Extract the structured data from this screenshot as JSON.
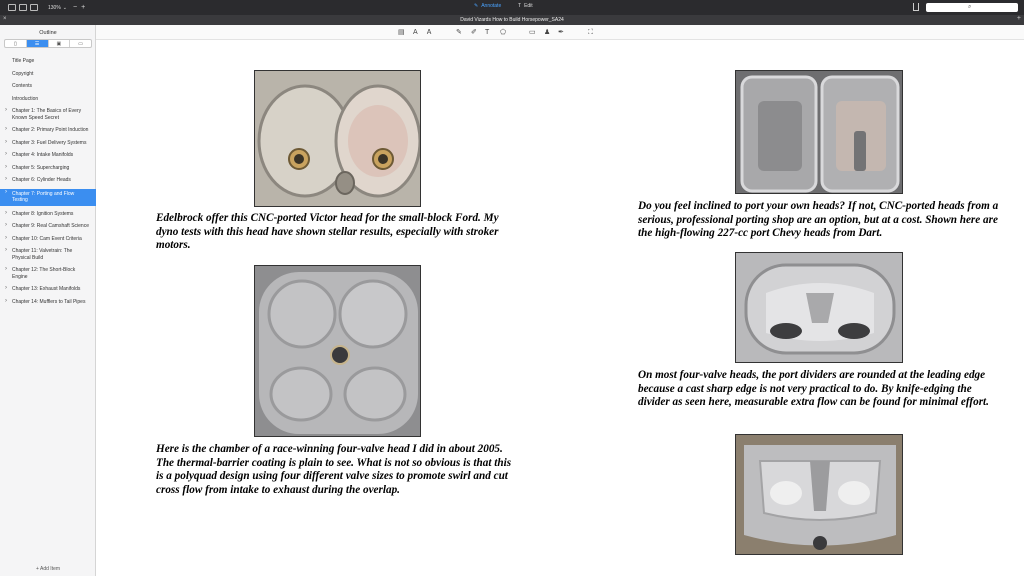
{
  "toolbar": {
    "zoom": "130%",
    "annotate_label": "Annotate",
    "edit_label": "Edit"
  },
  "document": {
    "title": "David Vizards How to Build Horsepower_SA24"
  },
  "sidebar": {
    "title": "Outline",
    "tabs": [
      "bookmark-icon",
      "outline-icon",
      "image-icon",
      "page-icon"
    ],
    "items": [
      {
        "label": "Title Page"
      },
      {
        "label": "Copyright"
      },
      {
        "label": "Contents"
      },
      {
        "label": "Introduction"
      },
      {
        "label": "Chapter 1: The Basics of Every Known Speed Secret"
      },
      {
        "label": "Chapter 2: Primary Point Induction"
      },
      {
        "label": "Chapter 3: Fuel Delivery Systems"
      },
      {
        "label": "Chapter 4: Intake Manifolds"
      },
      {
        "label": "Chapter 5: Supercharging"
      },
      {
        "label": "Chapter 6: Cylinder Heads"
      },
      {
        "label": "Chapter 7: Porting and Flow Testing"
      },
      {
        "label": "Chapter 8: Ignition Systems"
      },
      {
        "label": "Chapter 9: Real Camshaft Science"
      },
      {
        "label": "Chapter 10: Cam Event Criteria"
      },
      {
        "label": "Chapter 11: Valvetrain: The Physical Build"
      },
      {
        "label": "Chapter 12: The Short-Block Engine"
      },
      {
        "label": "Chapter 13: Exhaust Manifolds"
      },
      {
        "label": "Chapter 14: Mufflers to Tail Pipes"
      }
    ],
    "add_item": "Add Item"
  },
  "page": {
    "captions": [
      "Edelbrock offer this CNC-ported Victor head for the small-block Ford. My dyno tests with this head have shown stellar results, especially with stroker motors.",
      "Here is the chamber of a race-winning four-valve head I did in about 2005. The thermal-barrier coating is plain to see. What is not so obvious is that this is a polyquad design using four different valve sizes to promote swirl and cut cross flow from intake to exhaust during the overlap.",
      "Do you feel inclined to port your own heads? If not, CNC-ported heads from a serious, professional porting shop are an option, but at a cost. Shown here are the high-flowing 227-cc port Chevy heads from Dart.",
      "On most four-valve heads, the port dividers are rounded at the leading edge because a cast sharp edge is not very practical to do. By knife-edging the divider as seen here, measurable extra flow can be found for minimal effort."
    ]
  }
}
